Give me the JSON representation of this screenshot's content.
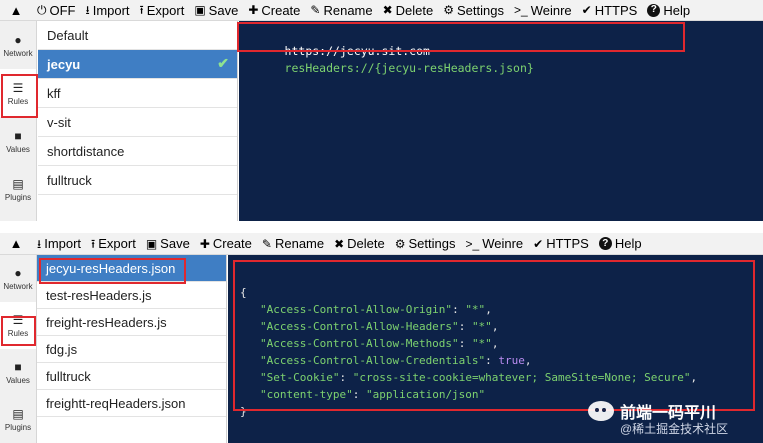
{
  "top": {
    "toolbar": {
      "collapse_icon": "chevron-up-icon",
      "items": [
        {
          "icon": "power-icon",
          "glyph": "⏻",
          "label": "OFF"
        },
        {
          "icon": "import-icon",
          "glyph": "⭳",
          "label": "Import"
        },
        {
          "icon": "export-icon",
          "glyph": "⭱",
          "label": "Export"
        },
        {
          "icon": "save-icon",
          "glyph": "▣",
          "label": "Save"
        },
        {
          "icon": "plus-icon",
          "glyph": "✚",
          "label": "Create"
        },
        {
          "icon": "edit-icon",
          "glyph": "✎",
          "label": "Rename"
        },
        {
          "icon": "trash-icon",
          "glyph": "✖",
          "label": "Delete"
        },
        {
          "icon": "gear-icon",
          "glyph": "⚙",
          "label": "Settings"
        },
        {
          "icon": "terminal-icon",
          "glyph": ">_",
          "label": "Weinre"
        },
        {
          "icon": "check-icon",
          "glyph": "✔",
          "label": "HTTPS"
        },
        {
          "icon": "help-icon",
          "glyph": "?",
          "label": "Help"
        }
      ]
    },
    "nav": [
      {
        "icon": "globe-icon",
        "glyph": "●",
        "label": "Network"
      },
      {
        "icon": "list-icon",
        "glyph": "☰",
        "label": "Rules"
      },
      {
        "icon": "folder-icon",
        "glyph": "■",
        "label": "Values"
      },
      {
        "icon": "plugin-icon",
        "glyph": "▤",
        "label": "Plugins"
      }
    ],
    "rules": [
      "Default",
      "jecyu",
      "kff",
      "v-sit",
      "shortdistance",
      "fulltruck"
    ],
    "selected_rule": "jecyu",
    "editor": {
      "url": "https://jecyu.sit.com",
      "directive": "resHeaders://{jecyu-resHeaders.json}"
    }
  },
  "bottom": {
    "toolbar": {
      "collapse_icon": "chevron-up-icon",
      "items": [
        {
          "icon": "import-icon",
          "glyph": "⭳",
          "label": "Import"
        },
        {
          "icon": "export-icon",
          "glyph": "⭱",
          "label": "Export"
        },
        {
          "icon": "save-icon",
          "glyph": "▣",
          "label": "Save"
        },
        {
          "icon": "plus-icon",
          "glyph": "✚",
          "label": "Create"
        },
        {
          "icon": "edit-icon",
          "glyph": "✎",
          "label": "Rename"
        },
        {
          "icon": "trash-icon",
          "glyph": "✖",
          "label": "Delete"
        },
        {
          "icon": "gear-icon",
          "glyph": "⚙",
          "label": "Settings"
        },
        {
          "icon": "terminal-icon",
          "glyph": ">_",
          "label": "Weinre"
        },
        {
          "icon": "check-icon",
          "glyph": "✔",
          "label": "HTTPS"
        },
        {
          "icon": "help-icon",
          "glyph": "?",
          "label": "Help"
        }
      ]
    },
    "nav": [
      {
        "icon": "globe-icon",
        "glyph": "●",
        "label": "Network"
      },
      {
        "icon": "list-icon",
        "glyph": "☰",
        "label": "Rules"
      },
      {
        "icon": "folder-icon",
        "glyph": "■",
        "label": "Values"
      },
      {
        "icon": "plugin-icon",
        "glyph": "▤",
        "label": "Plugins"
      }
    ],
    "values": [
      "jecyu-resHeaders.json",
      "test-resHeaders.js",
      "freight-resHeaders.js",
      "fdg.js",
      "fulltruck",
      "freightt-reqHeaders.json"
    ],
    "selected_value": "jecyu-resHeaders.json",
    "json_lines": [
      {
        "key": "",
        "value": "",
        "text": "{"
      },
      {
        "key": "\"Access-Control-Allow-Origin\"",
        "value": "\"*\"",
        "comma": ","
      },
      {
        "key": "\"Access-Control-Allow-Headers\"",
        "value": "\"*\"",
        "comma": ","
      },
      {
        "key": "\"Access-Control-Allow-Methods\"",
        "value": "\"*\"",
        "comma": ","
      },
      {
        "key": "\"Access-Control-Allow-Credentials\"",
        "value": "true",
        "comma": ",",
        "bool": true
      },
      {
        "key": "\"Set-Cookie\"",
        "value": "\"cross-site-cookie=whatever; SameSite=None; Secure\"",
        "comma": ","
      },
      {
        "key": "\"content-type\"",
        "value": "\"application/json\"",
        "comma": ""
      },
      {
        "key": "",
        "value": "",
        "text": "}"
      }
    ]
  },
  "watermark": {
    "title": "前端一码平川",
    "subtitle": "@稀土掘金技术社区"
  },
  "colors": {
    "accent": "#3f7ec4",
    "editor_bg": "#0d2248",
    "highlight": "#e0282e",
    "json_key": "#7dd26f"
  }
}
